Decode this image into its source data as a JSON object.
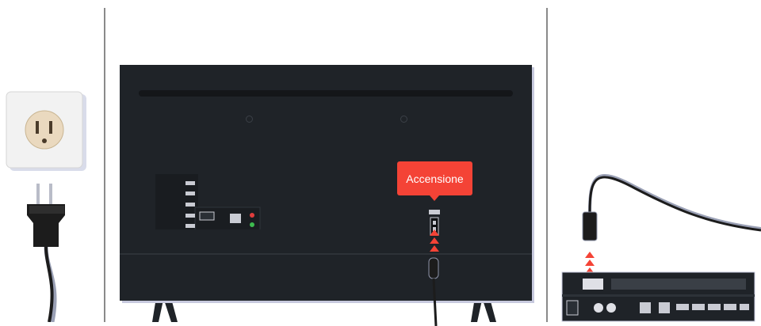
{
  "callout": {
    "label": "Accensione"
  },
  "colors": {
    "tv_body": "#1f2328",
    "accent_red": "#f44336",
    "outlet_face": "#f2f2f2",
    "plug": "#1c1c1c",
    "divider": "#8a8a8a"
  },
  "icons": [
    "wall-outlet-icon",
    "power-plug-icon",
    "tv-back-icon",
    "power-port-icon",
    "connect-arrows-icon",
    "one-connect-box-icon"
  ]
}
